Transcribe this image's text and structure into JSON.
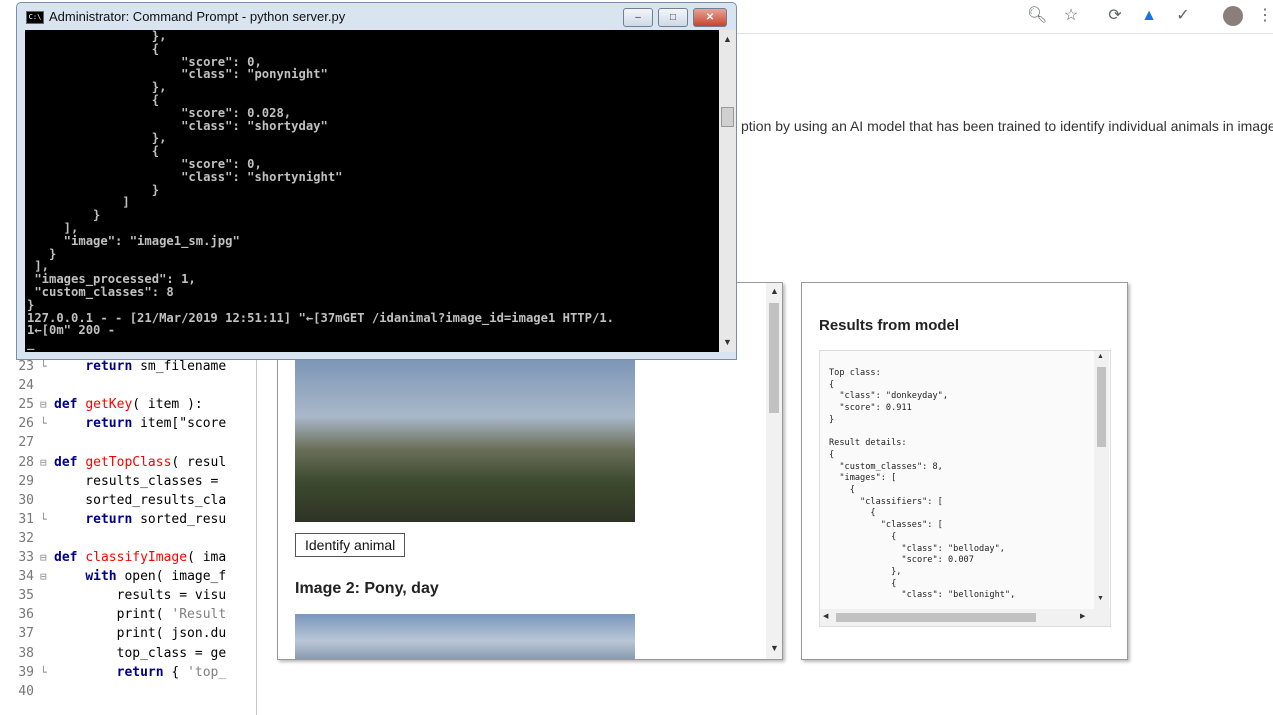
{
  "browser": {
    "toolbar_icons": [
      "zoom-icon",
      "star-icon",
      "extension-icon",
      "cast-icon",
      "checkmark-icon",
      "avatar",
      "menu-icon"
    ]
  },
  "page": {
    "intro_text": "ption by using an AI model that has been trained to identify individual animals in images:",
    "identify_button": "Identify animal",
    "image2_heading": "Image 2: Pony, day"
  },
  "results": {
    "title": "Results from model",
    "output": "Top class:\n{\n  \"class\": \"donkeyday\",\n  \"score\": 0.911\n}\n\nResult details:\n{\n  \"custom_classes\": 8,\n  \"images\": [\n    {\n      \"classifiers\": [\n        {\n          \"classes\": [\n            {\n              \"class\": \"belloday\",\n              \"score\": 0.007\n            },\n            {\n              \"class\": \"bellonight\","
  },
  "cmd": {
    "title": "Administrator: Command Prompt - python  server.py",
    "icon_label": "C:\\",
    "output": "                 },\n                 {\n                     \"score\": 0,\n                     \"class\": \"ponynight\"\n                 },\n                 {\n                     \"score\": 0.028,\n                     \"class\": \"shortyday\"\n                 },\n                 {\n                     \"score\": 0,\n                     \"class\": \"shortynight\"\n                 }\n             ]\n         }\n     ],\n     \"image\": \"image1_sm.jpg\"\n   }\n ],\n \"images_processed\": 1,\n \"custom_classes\": 8\n}\n127.0.0.1 - - [21/Mar/2019 12:51:11] \"←[37mGET /idanimal?image_id=image1 HTTP/1.\n1←[0m\" 200 -\n_"
  },
  "editor": {
    "lines": [
      {
        "n": "23",
        "fold": "└",
        "code": "    return sm_filename"
      },
      {
        "n": "24",
        "fold": "",
        "code": ""
      },
      {
        "n": "25",
        "fold": "⊟",
        "code": "def getKey( item ):"
      },
      {
        "n": "26",
        "fold": "└",
        "code": "    return item[\"score"
      },
      {
        "n": "27",
        "fold": "",
        "code": ""
      },
      {
        "n": "28",
        "fold": "⊟",
        "code": "def getTopClass( resul"
      },
      {
        "n": "29",
        "fold": "",
        "code": "    results_classes ="
      },
      {
        "n": "30",
        "fold": "",
        "code": "    sorted_results_cla"
      },
      {
        "n": "31",
        "fold": "└",
        "code": "    return sorted_resu"
      },
      {
        "n": "32",
        "fold": "",
        "code": ""
      },
      {
        "n": "33",
        "fold": "⊟",
        "code": "def classifyImage( ima"
      },
      {
        "n": "34",
        "fold": "⊟",
        "code": "    with open( image_f"
      },
      {
        "n": "35",
        "fold": "",
        "code": "        results = visu"
      },
      {
        "n": "36",
        "fold": "",
        "code": "        print( 'Result"
      },
      {
        "n": "37",
        "fold": "",
        "code": "        print( json.du"
      },
      {
        "n": "38",
        "fold": "",
        "code": "        top_class = ge"
      },
      {
        "n": "39",
        "fold": "└",
        "code": "        return { 'top_"
      },
      {
        "n": "40",
        "fold": "",
        "code": ""
      }
    ]
  }
}
